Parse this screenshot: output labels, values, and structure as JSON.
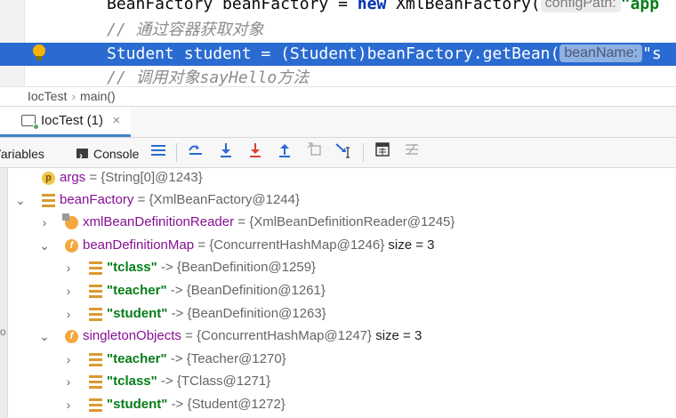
{
  "editor": {
    "line1": {
      "pre": "BeanFactory beanFactory = ",
      "kw": "new",
      "post": " XmlBeanFactory(",
      "hint": "configPath:",
      "str": "\"app"
    },
    "line2": {
      "comment": "// 通过容器获取对象"
    },
    "line3": {
      "text": "Student student = (Student)beanFactory.getBean(",
      "hint": "beanName:",
      "tail": "\"s"
    },
    "line4": {
      "comment": "// 调用对象sayHello方法"
    }
  },
  "breadcrumb": {
    "class_name": "IocTest",
    "separator": "›",
    "method": "main()"
  },
  "debug_tab": {
    "label": "IocTest (1)",
    "close": "×"
  },
  "toolbar": {
    "variables_label": "/ariables",
    "console_label": "Console",
    "icons": [
      "menu-icon",
      "show-execution-point-icon",
      "step-over-icon",
      "step-into-icon",
      "force-step-into-icon",
      "step-out-icon",
      "drop-frame-icon",
      "run-to-cursor-icon",
      "evaluate-expression-icon",
      "trace-current-stream-icon"
    ]
  },
  "tree": {
    "rows": [
      {
        "name": "args",
        "value": "= {String[0]@1243}"
      },
      {
        "name": "beanFactory",
        "value": "= {XmlBeanFactory@1244}"
      },
      {
        "name": "xmlBeanDefinitionReader",
        "value": "= {XmlBeanDefinitionReader@1245}"
      },
      {
        "name": "beanDefinitionMap",
        "value": "= {ConcurrentHashMap@1246}",
        "size": "size = 3"
      },
      {
        "key": "\"tclass\"",
        "value": "-> {BeanDefinition@1259}"
      },
      {
        "key": "\"teacher\"",
        "value": "-> {BeanDefinition@1261}"
      },
      {
        "key": "\"student\"",
        "value": "-> {BeanDefinition@1263}"
      },
      {
        "name": "singletonObjects",
        "value": "= {ConcurrentHashMap@1247}",
        "size": "size = 3"
      },
      {
        "key": "\"teacher\"",
        "value": "-> {Teacher@1270}"
      },
      {
        "key": "\"tclass\"",
        "value": "-> {TClass@1271}"
      },
      {
        "key": "\"student\"",
        "value": "-> {Student@1272}"
      }
    ]
  },
  "gutter_mark": "o"
}
